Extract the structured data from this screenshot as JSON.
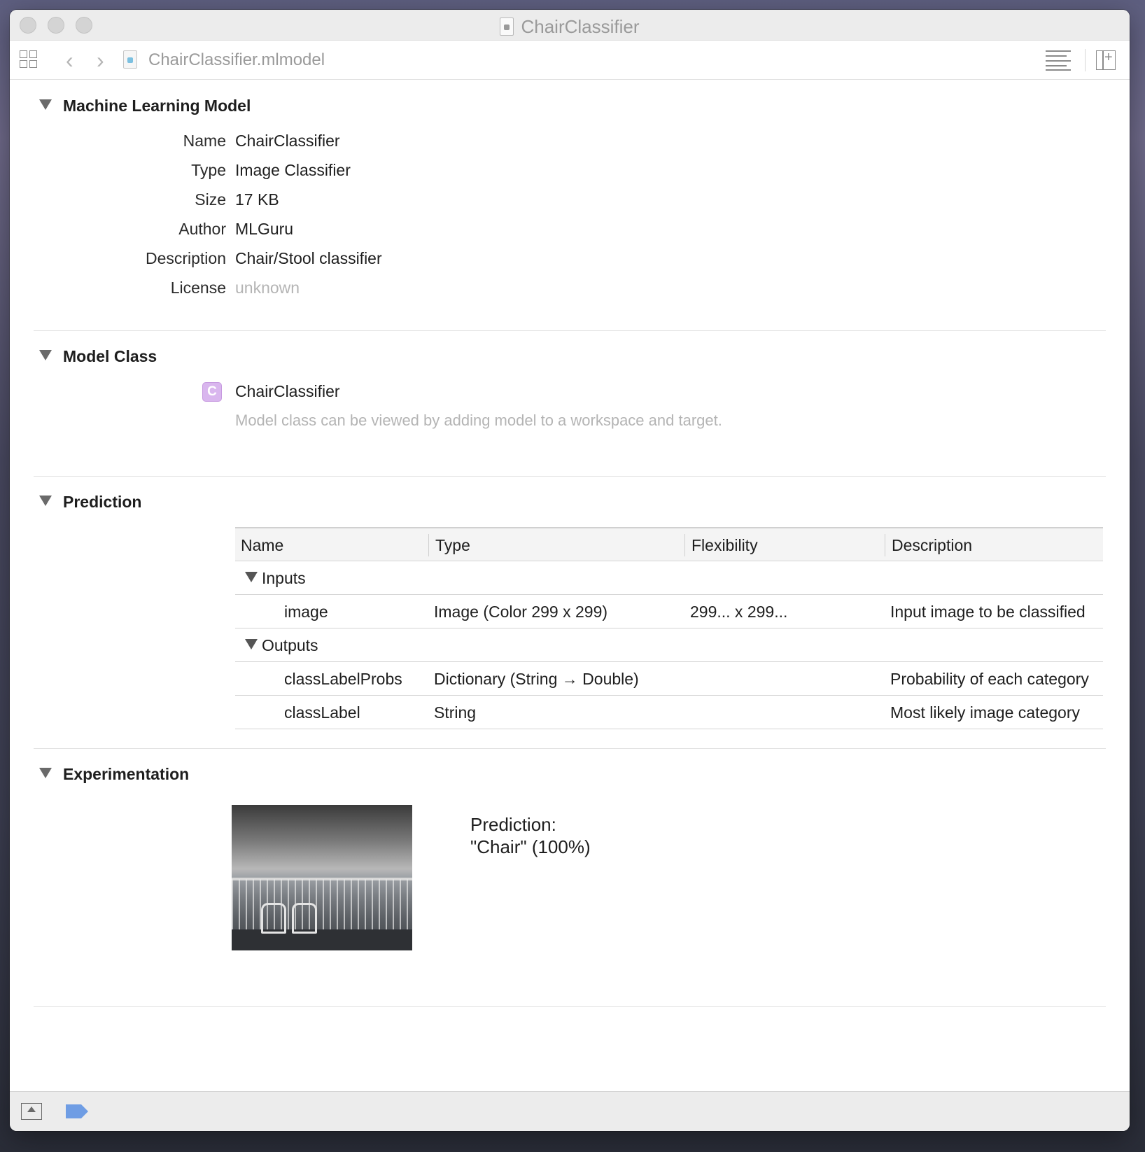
{
  "window": {
    "title": "ChairClassifier"
  },
  "toolbar": {
    "breadcrumb": "ChairClassifier.mlmodel",
    "back_icon": "chevron-left-icon",
    "forward_icon": "chevron-right-icon"
  },
  "sections": {
    "model": {
      "title": "Machine Learning Model",
      "props": [
        {
          "label": "Name",
          "value": "ChairClassifier"
        },
        {
          "label": "Type",
          "value": "Image Classifier"
        },
        {
          "label": "Size",
          "value": "17 KB"
        },
        {
          "label": "Author",
          "value": "MLGuru"
        },
        {
          "label": "Description",
          "value": "Chair/Stool classifier"
        },
        {
          "label": "License",
          "value": "unknown"
        }
      ]
    },
    "model_class": {
      "title": "Model Class",
      "badge": "C",
      "class_name": "ChairClassifier",
      "note": "Model class can be viewed by adding model to a workspace and target."
    },
    "prediction": {
      "title": "Prediction",
      "columns": [
        "Name",
        "Type",
        "Flexibility",
        "Description"
      ],
      "inputs_label": "Inputs",
      "outputs_label": "Outputs",
      "inputs": [
        {
          "name": "image",
          "type": "Image (Color 299 x 299)",
          "flexibility": "299... x 299...",
          "description": "Input image to be classified"
        }
      ],
      "outputs": [
        {
          "name": "classLabelProbs",
          "type": "Dictionary (String → Double)",
          "flexibility": "",
          "description": "Probability of each category"
        },
        {
          "name": "classLabel",
          "type": "String",
          "flexibility": "",
          "description": "Most likely image category"
        }
      ]
    },
    "experimentation": {
      "title": "Experimentation",
      "prediction_line1": "Prediction:",
      "prediction_line2": "\"Chair\" (100%)"
    }
  },
  "colors": {
    "class_badge": "#d9b6ee",
    "tag": "#6f9de4"
  }
}
